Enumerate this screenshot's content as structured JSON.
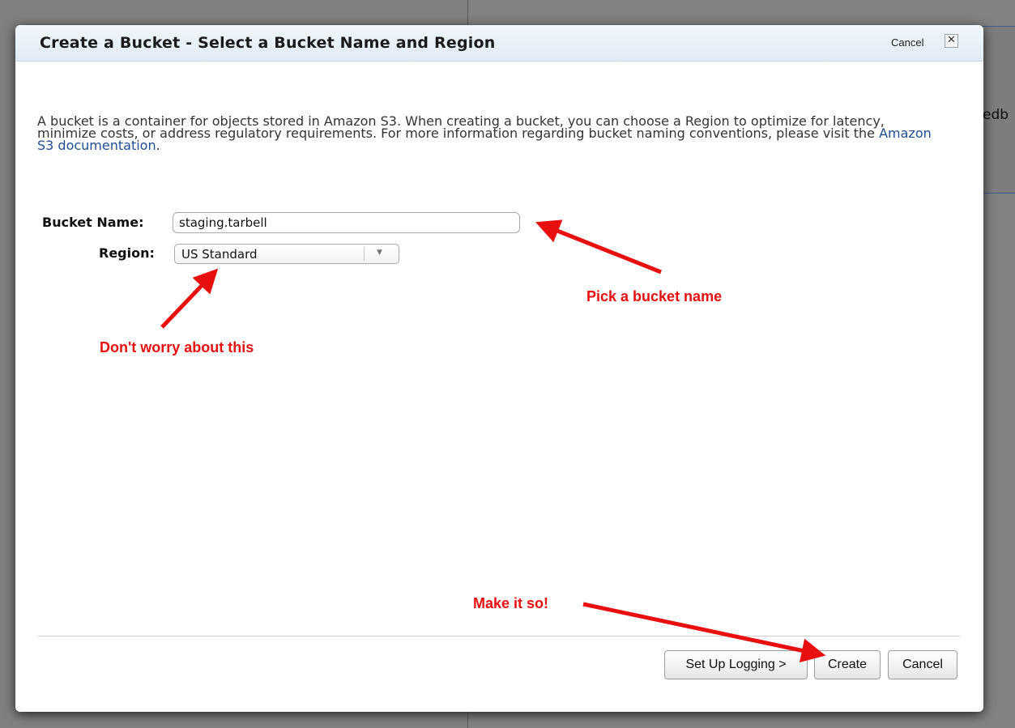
{
  "background": {
    "partial_text": "edb"
  },
  "dialog": {
    "title": "Create a Bucket - Select a Bucket Name and Region",
    "header_cancel_label": "Cancel",
    "close_glyph": "✕",
    "description_text": "A bucket is a container for objects stored in Amazon S3. When creating a bucket, you can choose a Region to optimize for latency, minimize costs, or address regulatory requirements. For more information regarding bucket naming conventions, please visit the",
    "description_link": "Amazon S3 documentation",
    "description_end": "."
  },
  "form": {
    "bucket_name_label": "Bucket Name:",
    "bucket_name_value": "staging.tarbell",
    "region_label": "Region:",
    "region_value": "US Standard"
  },
  "footer": {
    "setup_logging_label": "Set Up Logging >",
    "create_label": "Create",
    "cancel_label": "Cancel"
  },
  "annotations": {
    "pick_name": "Pick a bucket name",
    "dont_worry": "Don't worry about this",
    "make_it_so": "Make it so!",
    "color": "#e8100f"
  }
}
